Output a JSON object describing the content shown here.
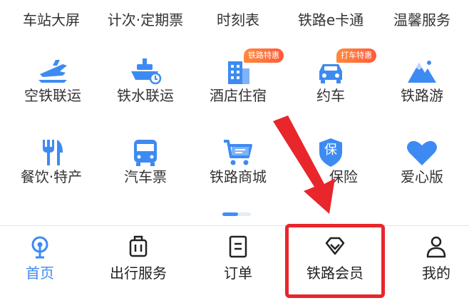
{
  "colors": {
    "primary_blue": "#3d8bf2",
    "badge_orange": "#ff6a3a",
    "annotation_red": "#e8262b",
    "text": "#333333"
  },
  "grid": {
    "row1": [
      "车站大屏",
      "计次·定期票",
      "时刻表",
      "铁路e卡通",
      "温馨服务"
    ],
    "row2": [
      {
        "label": "空铁联运",
        "icon": "plane-train-icon"
      },
      {
        "label": "铁水联运",
        "icon": "ship-icon"
      },
      {
        "label": "酒店住宿",
        "icon": "hotel-icon",
        "badge": "铁路特惠"
      },
      {
        "label": "约车",
        "icon": "car-icon",
        "badge": "打车特惠"
      },
      {
        "label": "铁路游",
        "icon": "mountain-icon"
      }
    ],
    "row3": [
      {
        "label": "餐饮·特产",
        "icon": "fork-knife-icon"
      },
      {
        "label": "汽车票",
        "icon": "bus-icon"
      },
      {
        "label": "铁路商城",
        "icon": "shopping-cart-icon"
      },
      {
        "label": "铁路保险",
        "visible_label": "保险",
        "icon": "insurance-shield-icon",
        "icon_text": "保"
      },
      {
        "label": "爱心版",
        "icon": "heart-icon"
      }
    ]
  },
  "tabs": [
    {
      "label": "首页",
      "icon": "home-train-icon",
      "active": true
    },
    {
      "label": "出行服务",
      "icon": "luggage-icon"
    },
    {
      "label": "订单",
      "icon": "order-list-icon"
    },
    {
      "label": "铁路会员",
      "icon": "diamond-icon"
    },
    {
      "label": "我的",
      "icon": "person-icon"
    }
  ]
}
